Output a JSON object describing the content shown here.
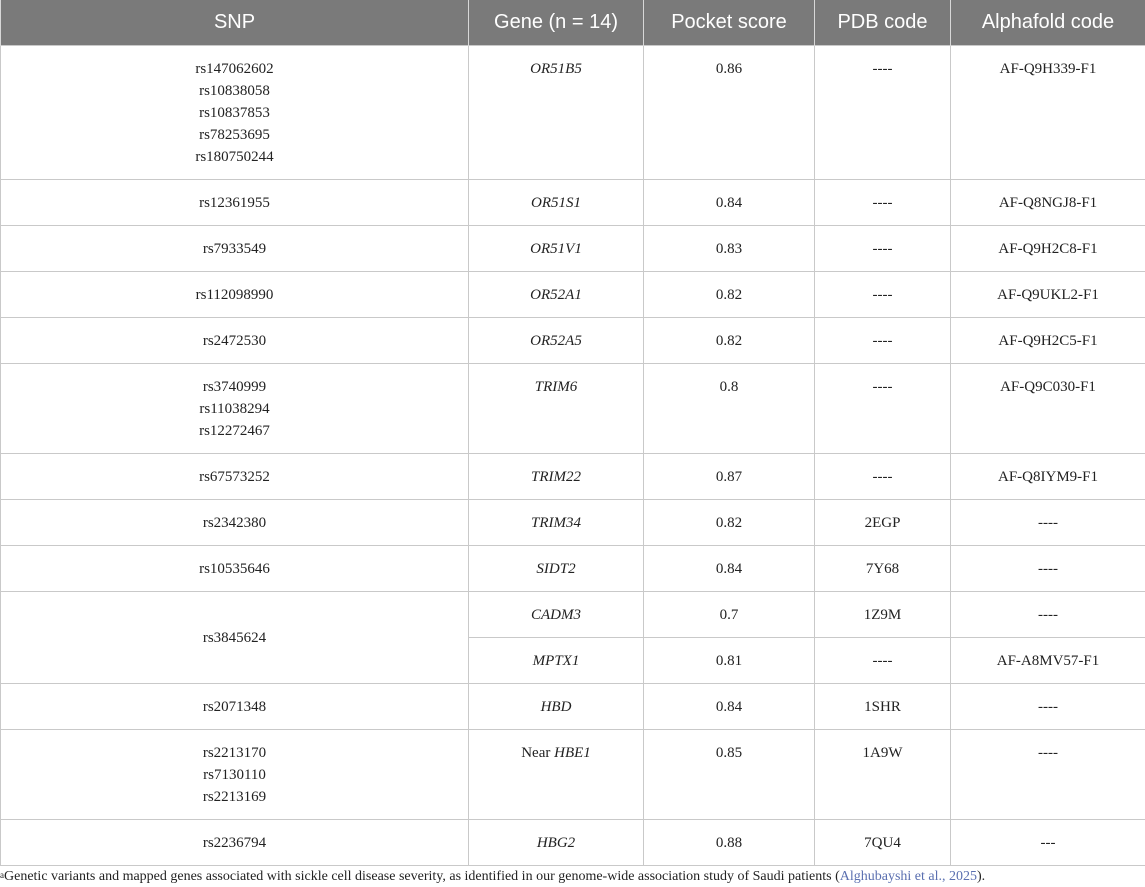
{
  "table": {
    "headers": [
      "SNP",
      "Gene (n = 14)",
      "Pocket score",
      "PDB code",
      "Alphafold code"
    ],
    "rows": [
      {
        "snp": [
          "rs147062602",
          "rs10838058",
          "rs10837853",
          "rs78253695",
          "rs180750244"
        ],
        "gene_prefix": "",
        "gene": "OR51B5",
        "pocket_score": "0.86",
        "pdb": "----",
        "alphafold": "AF-Q9H339-F1"
      },
      {
        "snp": [
          "rs12361955"
        ],
        "gene_prefix": "",
        "gene": "OR51S1",
        "pocket_score": "0.84",
        "pdb": "----",
        "alphafold": "AF-Q8NGJ8-F1"
      },
      {
        "snp": [
          "rs7933549"
        ],
        "gene_prefix": "",
        "gene": "OR51V1",
        "pocket_score": "0.83",
        "pdb": "----",
        "alphafold": "AF-Q9H2C8-F1"
      },
      {
        "snp": [
          "rs112098990"
        ],
        "gene_prefix": "",
        "gene": "OR52A1",
        "pocket_score": "0.82",
        "pdb": "----",
        "alphafold": "AF-Q9UKL2-F1"
      },
      {
        "snp": [
          "rs2472530"
        ],
        "gene_prefix": "",
        "gene": "OR52A5",
        "pocket_score": "0.82",
        "pdb": "----",
        "alphafold": "AF-Q9H2C5-F1"
      },
      {
        "snp": [
          "rs3740999",
          "rs11038294",
          "rs12272467"
        ],
        "gene_prefix": "",
        "gene": "TRIM6",
        "pocket_score": "0.8",
        "pdb": "----",
        "alphafold": "AF-Q9C030-F1"
      },
      {
        "snp": [
          "rs67573252"
        ],
        "gene_prefix": "",
        "gene": "TRIM22",
        "pocket_score": "0.87",
        "pdb": "----",
        "alphafold": "AF-Q8IYM9-F1"
      },
      {
        "snp": [
          "rs2342380"
        ],
        "gene_prefix": "",
        "gene": "TRIM34",
        "pocket_score": "0.82",
        "pdb": "2EGP",
        "alphafold": "----"
      },
      {
        "snp": [
          "rs10535646"
        ],
        "gene_prefix": "",
        "gene": "SIDT2",
        "pocket_score": "0.84",
        "pdb": "7Y68",
        "alphafold": "----"
      },
      {
        "snp": [
          "rs3845624"
        ],
        "snp_rowspan": 2,
        "gene_prefix": "",
        "gene": "CADM3",
        "pocket_score": "0.7",
        "pdb": "1Z9M",
        "alphafold": "----"
      },
      {
        "snp": [],
        "snp_merged_above": true,
        "gene_prefix": "",
        "gene": "MPTX1",
        "pocket_score": "0.81",
        "pdb": "----",
        "alphafold": "AF-A8MV57-F1"
      },
      {
        "snp": [
          "rs2071348"
        ],
        "gene_prefix": "",
        "gene": "HBD",
        "pocket_score": "0.84",
        "pdb": "1SHR",
        "alphafold": "----"
      },
      {
        "snp": [
          "rs2213170",
          "rs7130110",
          "rs2213169"
        ],
        "gene_prefix": "Near ",
        "gene": "HBE1",
        "pocket_score": "0.85",
        "pdb": "1A9W",
        "alphafold": "----"
      },
      {
        "snp": [
          "rs2236794"
        ],
        "gene_prefix": "",
        "gene": "HBG2",
        "pocket_score": "0.88",
        "pdb": "7QU4",
        "alphafold": "---"
      }
    ]
  },
  "footnote": {
    "marker": "a",
    "text_before": "Genetic variants and mapped genes associated with sickle cell disease severity, as identified in our genome-wide association study of Saudi patients (",
    "citation": "Alghubayshi et al., 2025",
    "text_after": ")."
  }
}
